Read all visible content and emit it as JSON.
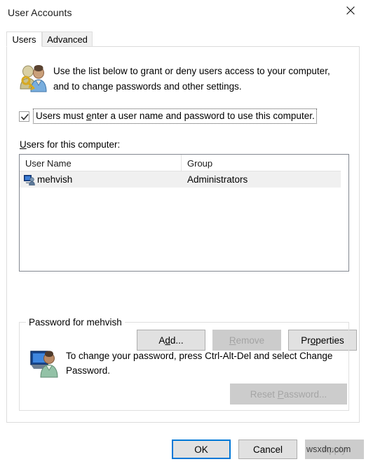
{
  "window": {
    "title": "User Accounts",
    "close_icon": "close-icon"
  },
  "tabs": [
    {
      "label": "Users",
      "active": true
    },
    {
      "label": "Advanced",
      "active": false
    }
  ],
  "intro": {
    "icon": "users-with-key-icon",
    "text": "Use the list below to grant or deny users access to your computer, and to change passwords and other settings."
  },
  "require_password_checkbox": {
    "checked": true,
    "label_before": "Users must ",
    "label_accesskey": "e",
    "label_after": "nter a user name and password to use this computer.",
    "focused": true
  },
  "users_list": {
    "label_accesskey": "U",
    "label_after": "sers for this computer:",
    "columns": [
      "User Name",
      "Group"
    ],
    "rows": [
      {
        "icon": "user-account-icon",
        "user_name": "mehvish",
        "group": "Administrators",
        "selected": true
      }
    ]
  },
  "action_buttons": {
    "add": {
      "before": "A",
      "accesskey": "d",
      "after": "d...",
      "enabled": true
    },
    "remove": {
      "before": "",
      "accesskey": "R",
      "after": "emove",
      "enabled": false
    },
    "properties": {
      "before": "Pr",
      "accesskey": "o",
      "after": "perties",
      "enabled": true
    }
  },
  "password_group": {
    "legend": "Password for mehvish",
    "icon": "user-account-icon",
    "text": "To change your password, press Ctrl-Alt-Del and select Change Password.",
    "reset_button": {
      "before": "Reset ",
      "accesskey": "P",
      "after": "assword...",
      "enabled": false
    }
  },
  "footer": {
    "ok": {
      "label": "OK",
      "default": true
    },
    "cancel": {
      "label": "Cancel"
    },
    "apply": {
      "label": "Apply",
      "enabled": false
    }
  },
  "watermark": "wsxdn.com",
  "colors": {
    "accent": "#0078d7",
    "button_face": "#e1e1e1",
    "disabled_face": "#cccccc",
    "selection": "#f0f0f0"
  }
}
